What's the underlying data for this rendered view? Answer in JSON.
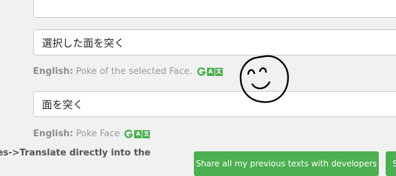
{
  "fields": {
    "top_value": "",
    "field1_value": "選択した面を突く",
    "field2_value": "面を突く"
  },
  "hints": {
    "label": "English:",
    "hint1_text": "Poke of the selected Face.",
    "hint2_text": "Poke Face"
  },
  "translate_icons": {
    "g_icon": "google-translate-g-icon",
    "a_icon_text": "A",
    "kanji_icon_text": "文",
    "accent_color": "#4caf50"
  },
  "description": {
    "text": "ces->Translate directly into the"
  },
  "buttons": {
    "share_label": "Share all my previous texts with developers",
    "next_label": "S"
  },
  "colors": {
    "background": "#f1f1f1",
    "button_green": "#4caf50"
  }
}
